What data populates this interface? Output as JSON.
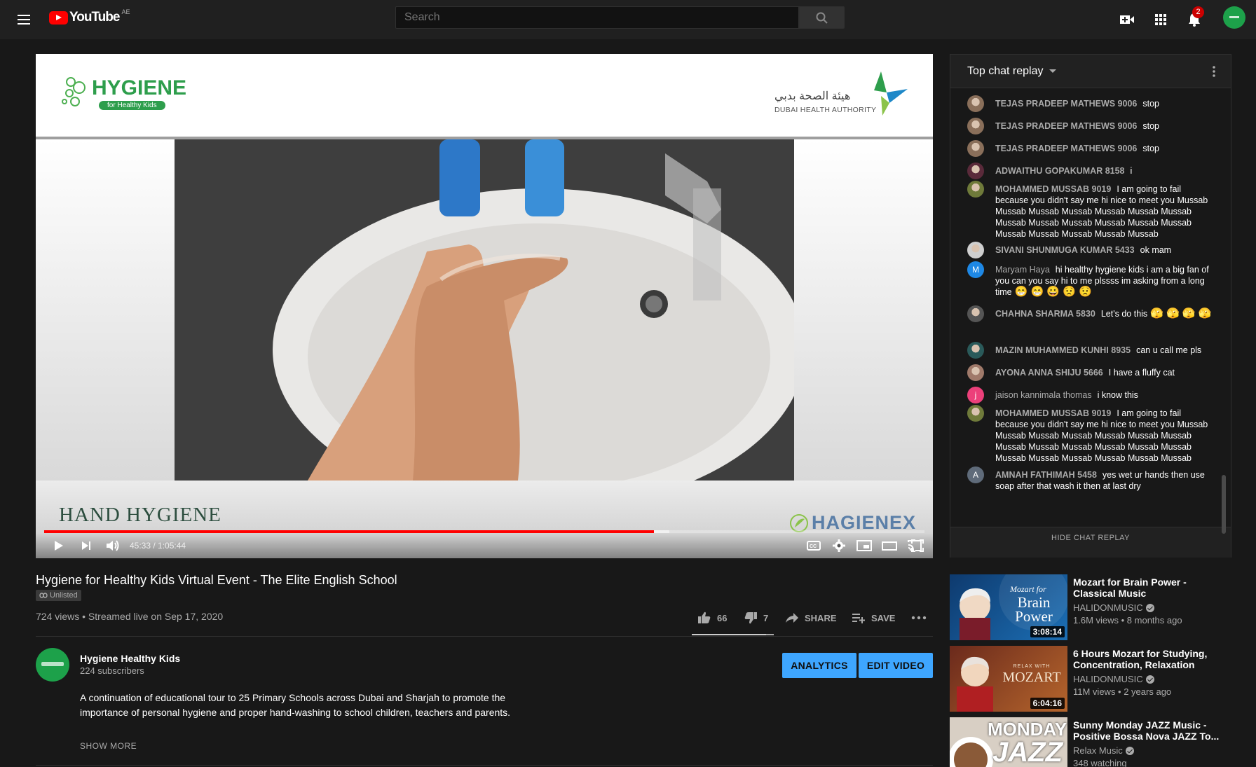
{
  "header": {
    "logo_text": "YouTube",
    "region": "AE",
    "search_placeholder": "Search",
    "notification_count": "2"
  },
  "video": {
    "overlay_title": "HAND HYGIENE",
    "brand_right": "HAGIENEX",
    "brand_left": "HYGIENE",
    "brand_left_sub": "for Healthy Kids",
    "authority": "DUBAI HEALTH AUTHORITY",
    "authority_ar": "هيئة الصحة بدبي",
    "time": "45:33 / 1:05:44",
    "progress_fraction": 0.693,
    "buffer_fraction": 0.71
  },
  "info": {
    "title": "Hygiene for Healthy Kids Virtual Event - The Elite English School",
    "unlisted": "Unlisted",
    "views": "724 views • Streamed live on Sep 17, 2020",
    "likes": "66",
    "dislikes": "7",
    "share_label": "SHARE",
    "save_label": "SAVE",
    "like_fraction": 0.904
  },
  "channel": {
    "name": "Hygiene Healthy Kids",
    "subscribers": "224 subscribers",
    "analytics_label": "ANALYTICS",
    "edit_label": "EDIT VIDEO",
    "description": "A continuation of educational tour to 25 Primary Schools across Dubai and Sharjah to promote the importance of personal hygiene and proper hand-washing to school children, teachers and parents.",
    "show_more": "SHOW MORE"
  },
  "chat": {
    "title": "Top chat replay",
    "hide_label": "HIDE CHAT REPLAY",
    "messages": [
      {
        "author": "TEJAS PRADEEP MATHEWS 9006",
        "text": "stop",
        "avatar": "photo",
        "color": "#8a6f5a"
      },
      {
        "author": "TEJAS PRADEEP MATHEWS 9006",
        "text": "stop",
        "avatar": "photo",
        "color": "#8a6f5a"
      },
      {
        "author": "TEJAS PRADEEP MATHEWS 9006",
        "text": "stop",
        "avatar": "photo",
        "color": "#8a6f5a"
      },
      {
        "author": "ADWAITHU GOPAKUMAR 8158",
        "text": "i",
        "avatar": "photo",
        "color": "#5a2a3a"
      },
      {
        "author": "MOHAMMED MUSSAB 9019",
        "text": "I am going to fail because you didn't say me hi nice to meet you Mussab Mussab Mussab Mussab Mussab Mussab Mussab Mussab Mussab Mussab Mussab Mussab Mussab Mussab Mussab Mussab Mussab Mussab",
        "avatar": "photo",
        "color": "#6f7a3a"
      },
      {
        "author": "SIVANI SHUNMUGA KUMAR 5433",
        "text": "ok mam",
        "avatar": "photo",
        "color": "#cfcfcf"
      },
      {
        "author": "Maryam Haya",
        "text": "hi healthy hygiene kids i am a big fan of you can you say hi to me plssss im asking from a long time",
        "emoji": "😁 😁 😀 😟 😟",
        "avatar": "letter",
        "letter": "M",
        "color": "#1e88e5",
        "plain": true
      },
      {
        "author": "CHAHNA SHARMA 5830",
        "text": "Let's do this",
        "emoji": "🫣 🫣 🫣 🫣",
        "avatar": "photo",
        "color": "#555555"
      },
      {
        "author": "MAZIN MUHAMMED KUNHI 8935",
        "text": "can u call me pls",
        "avatar": "photo",
        "color": "#2a5a5a"
      },
      {
        "author": "AYONA ANNA SHIJU 5666",
        "text": "I have a fluffy cat",
        "avatar": "photo",
        "color": "#a07a6a"
      },
      {
        "author": "jaison kannimala thomas",
        "text": "i know this",
        "avatar": "letter",
        "letter": "j",
        "color": "#ec407a",
        "plain": true
      },
      {
        "author": "MOHAMMED MUSSAB 9019",
        "text": "I am going to fail because you didn't say me hi nice to meet you Mussab Mussab Mussab Mussab Mussab Mussab Mussab Mussab Mussab Mussab Mussab Mussab Mussab Mussab Mussab Mussab Mussab Mussab Mussab",
        "avatar": "photo",
        "color": "#6f7a3a"
      },
      {
        "author": "AMNAH FATHIMAH 5458",
        "text": "yes wet ur hands then use soap after that wash it then at last dry",
        "avatar": "letter",
        "letter": "A",
        "color": "#5f6b7a"
      }
    ]
  },
  "recommendations": [
    {
      "title": "Mozart for Brain Power - Classical Music",
      "channel": "HALIDONMUSIC",
      "meta": "1.6M views • 8 months ago",
      "duration": "3:08:14",
      "thumb_text": "Brain Power",
      "thumb_small": "Mozart for"
    },
    {
      "title": "6 Hours Mozart for Studying, Concentration, Relaxation",
      "channel": "HALIDONMUSIC",
      "meta": "11M views • 2 years ago",
      "duration": "6:04:16",
      "thumb_text": "MOZART",
      "thumb_small": "RELAX WITH"
    },
    {
      "title": "Sunny Monday JAZZ Music - Positive Bossa Nova JAZZ To...",
      "channel": "Relax Music",
      "meta": "348 watching",
      "duration": "",
      "thumb_text": "JAZZ",
      "thumb_small": "MONDAY"
    }
  ]
}
